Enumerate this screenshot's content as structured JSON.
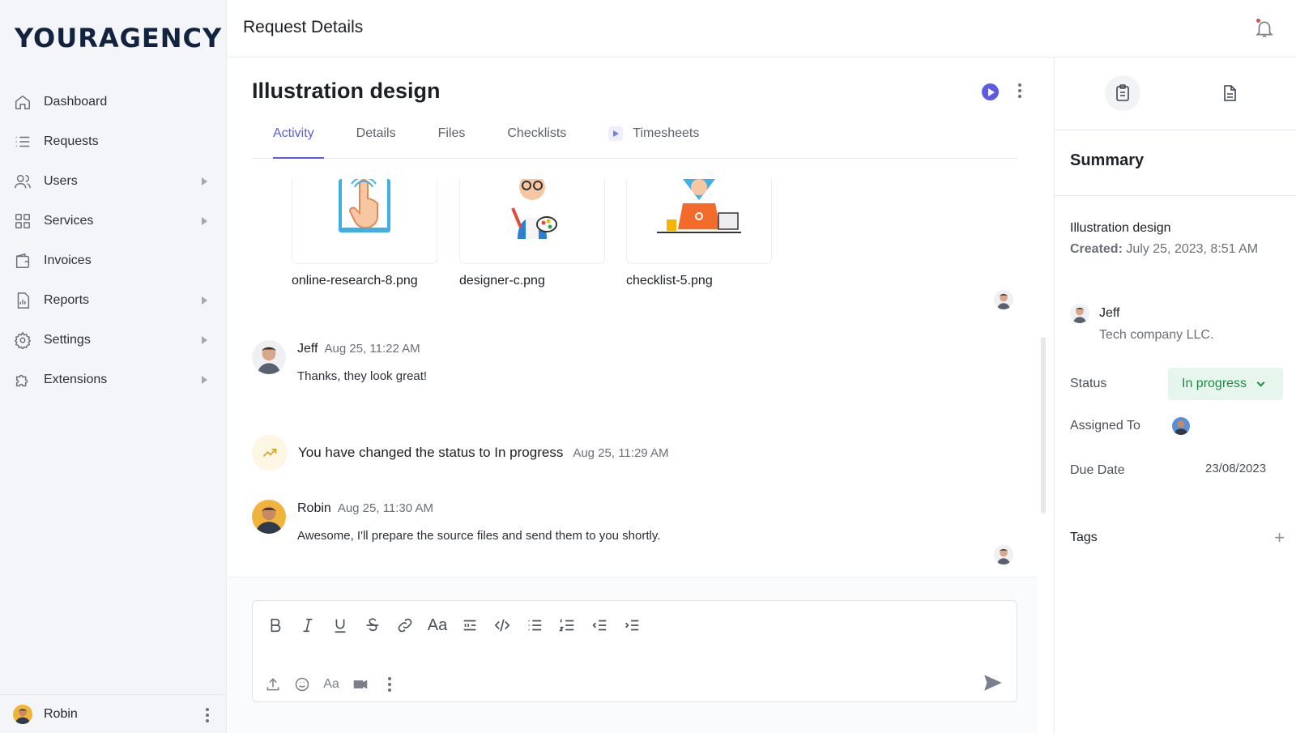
{
  "brand": {
    "logo_text": "YOURAGENCY"
  },
  "sidebar": {
    "items": [
      {
        "label": "Dashboard",
        "icon": "home-icon",
        "has_submenu": false
      },
      {
        "label": "Requests",
        "icon": "list-icon",
        "has_submenu": false
      },
      {
        "label": "Users",
        "icon": "users-icon",
        "has_submenu": true
      },
      {
        "label": "Services",
        "icon": "grid-icon",
        "has_submenu": true
      },
      {
        "label": "Invoices",
        "icon": "wallet-icon",
        "has_submenu": false
      },
      {
        "label": "Reports",
        "icon": "report-icon",
        "has_submenu": true
      },
      {
        "label": "Settings",
        "icon": "gear-icon",
        "has_submenu": true
      },
      {
        "label": "Extensions",
        "icon": "puzzle-icon",
        "has_submenu": true
      }
    ],
    "user": {
      "name": "Robin"
    }
  },
  "header": {
    "title": "Request Details",
    "icon": "bell-icon"
  },
  "request": {
    "title": "Illustration design",
    "tabs": [
      {
        "label": "Activity",
        "active": true
      },
      {
        "label": "Details",
        "active": false
      },
      {
        "label": "Files",
        "active": false
      },
      {
        "label": "Checklists",
        "active": false
      },
      {
        "label": "Timesheets",
        "active": false
      }
    ]
  },
  "files": [
    {
      "name": "online-research-8.png"
    },
    {
      "name": "designer-c.png"
    },
    {
      "name": "checklist-5.png"
    }
  ],
  "messages": [
    {
      "author": "Jeff",
      "time": "Aug 25, 11:22 AM",
      "text": "Thanks, they look great!"
    },
    {
      "author": "Robin",
      "time": "Aug 25, 11:30 AM",
      "text": "Awesome, I'll prepare the source files and send them to you shortly."
    }
  ],
  "status_event": {
    "text": "You have changed the status to In progress",
    "time": "Aug 25, 11:29 AM"
  },
  "composer": {
    "format_tools": [
      "bold-icon",
      "italic-icon",
      "underline-icon",
      "strikethrough-icon",
      "link-icon",
      "font-size-icon",
      "quote-icon",
      "code-icon",
      "bulleted-list-icon",
      "numbered-list-icon",
      "outdent-icon",
      "indent-icon"
    ],
    "font_glyph": "Aa",
    "bottom_tools": [
      "upload-icon",
      "emoji-icon",
      "text-format-icon",
      "video-icon",
      "more-icon"
    ]
  },
  "summary": {
    "heading": "Summary",
    "project": "Illustration design",
    "created_label": "Created:",
    "created_value": "July 25, 2023, 8:51 AM",
    "client_name": "Jeff",
    "client_company": "Tech company LLC.",
    "status_label": "Status",
    "status_value": "In progress",
    "assigned_label": "Assigned To",
    "due_label": "Due Date",
    "due_value": "23/08/2023",
    "tags_label": "Tags",
    "tags_add": "+"
  },
  "colors": {
    "accent": "#5b5ce2",
    "status_bg": "#e6f6ec",
    "status_text": "#1e8a45",
    "sidebar_bg": "#f4f5f8"
  }
}
